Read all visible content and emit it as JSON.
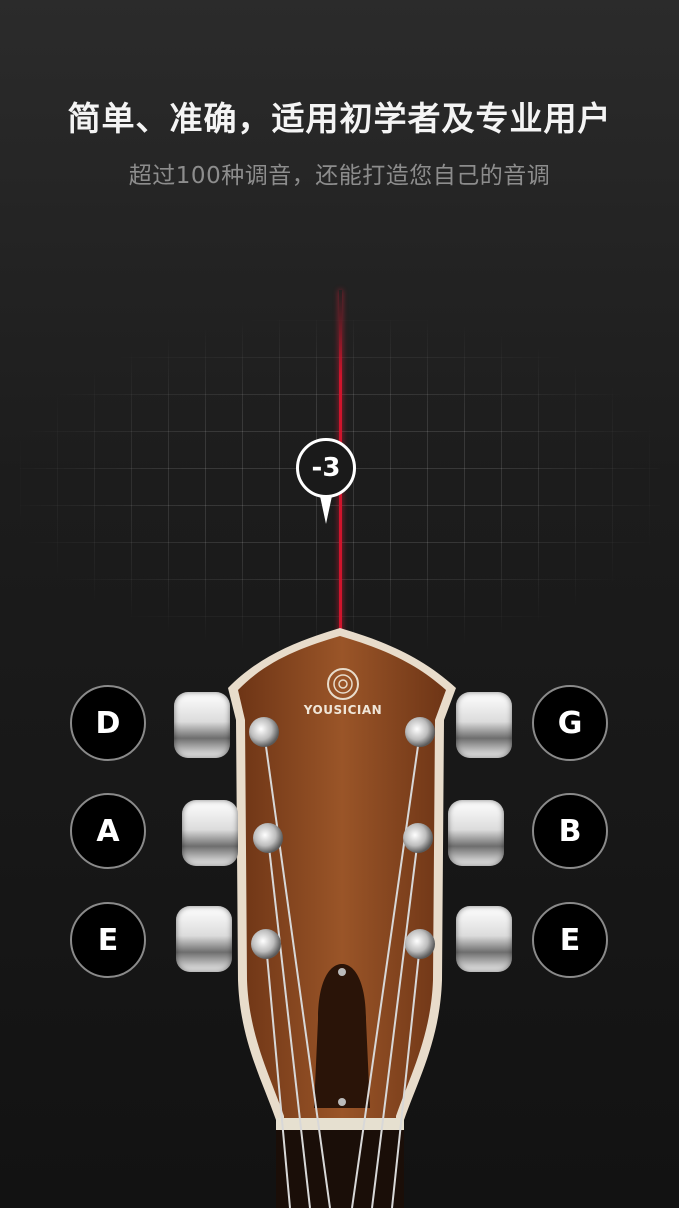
{
  "header": {
    "title": "简单、准确，适用初学者及专业用户",
    "subtitle": "超过100种调音，还能打造您自己的音调"
  },
  "tuner": {
    "offset_label": "-3",
    "brand": "YOUSICIAN",
    "left_strings": [
      "D",
      "A",
      "E"
    ],
    "right_strings": [
      "G",
      "B",
      "E"
    ]
  },
  "colors": {
    "background": "#1c1c1c",
    "needle": "#d0142c",
    "wood": "#8a4a22"
  }
}
